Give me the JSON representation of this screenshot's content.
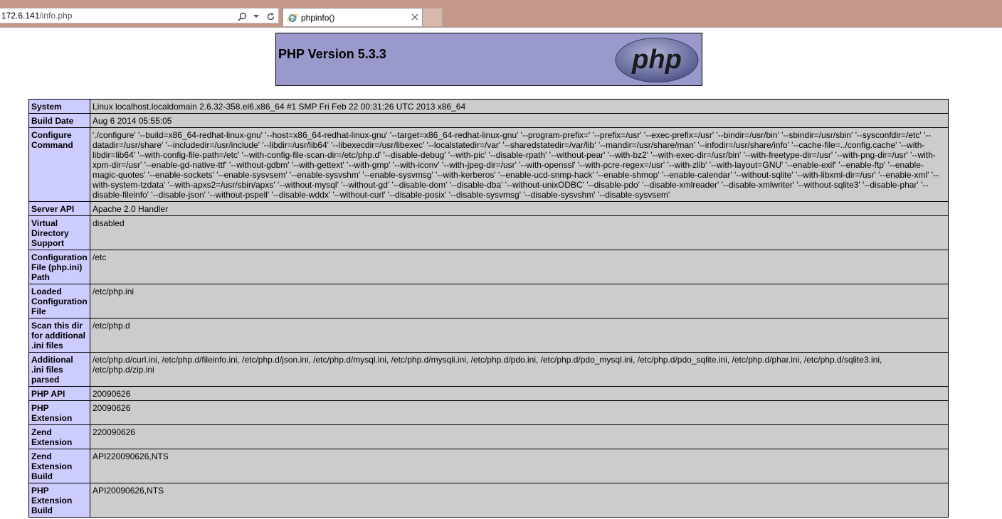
{
  "browser": {
    "address": {
      "host": "172.6.141",
      "path": "/info.php"
    },
    "tab": {
      "title": "phpinfo()"
    },
    "icons": [
      "search-icon",
      "dropdown-icon",
      "refresh-icon",
      "ie-favicon",
      "close-icon"
    ]
  },
  "header": {
    "title": "PHP Version 5.3.3",
    "logo_text": "php",
    "colors": {
      "header_bg": "#9999cc",
      "label_bg": "#ccccff",
      "value_bg": "#cccccc"
    }
  },
  "rows": [
    {
      "label": "System",
      "value": "Linux localhost.localdomain 2.6.32-358.el6.x86_64 #1 SMP Fri Feb 22 00:31:26 UTC 2013 x86_64"
    },
    {
      "label": "Build Date",
      "value": "Aug 6 2014 05:55:05"
    },
    {
      "label": "Configure Command",
      "value": "'./configure' '--build=x86_64-redhat-linux-gnu' '--host=x86_64-redhat-linux-gnu' '--target=x86_64-redhat-linux-gnu' '--program-prefix=' '--prefix=/usr' '--exec-prefix=/usr' '--bindir=/usr/bin' '--sbindir=/usr/sbin' '--sysconfdir=/etc' '--datadir=/usr/share' '--includedir=/usr/include' '--libdir=/usr/lib64' '--libexecdir=/usr/libexec' '--localstatedir=/var' '--sharedstatedir=/var/lib' '--mandir=/usr/share/man' '--infodir=/usr/share/info' '--cache-file=../config.cache' '--with-libdir=lib64' '--with-config-file-path=/etc' '--with-config-file-scan-dir=/etc/php.d' '--disable-debug' '--with-pic' '--disable-rpath' '--without-pear' '--with-bz2' '--with-exec-dir=/usr/bin' '--with-freetype-dir=/usr' '--with-png-dir=/usr' '--with-xpm-dir=/usr' '--enable-gd-native-ttf' '--without-gdbm' '--with-gettext' '--with-gmp' '--with-iconv' '--with-jpeg-dir=/usr' '--with-openssl' '--with-pcre-regex=/usr' '--with-zlib' '--with-layout=GNU' '--enable-exif' '--enable-ftp' '--enable-magic-quotes' '--enable-sockets' '--enable-sysvsem' '--enable-sysvshm' '--enable-sysvmsg' '--with-kerberos' '--enable-ucd-snmp-hack' '--enable-shmop' '--enable-calendar' '--without-sqlite' '--with-libxml-dir=/usr' '--enable-xml' '--with-system-tzdata' '--with-apxs2=/usr/sbin/apxs' '--without-mysql' '--without-gd' '--disable-dom' '--disable-dba' '--without-unixODBC' '--disable-pdo' '--disable-xmlreader' '--disable-xmlwriter' '--without-sqlite3' '--disable-phar' '--disable-fileinfo' '--disable-json' '--without-pspell' '--disable-wddx' '--without-curl' '--disable-posix' '--disable-sysvmsg' '--disable-sysvshm' '--disable-sysvsem'"
    },
    {
      "label": "Server API",
      "value": "Apache 2.0 Handler"
    },
    {
      "label": "Virtual Directory Support",
      "value": "disabled"
    },
    {
      "label": "Configuration File (php.ini) Path",
      "value": "/etc"
    },
    {
      "label": "Loaded Configuration File",
      "value": "/etc/php.ini"
    },
    {
      "label": "Scan this dir for additional .ini files",
      "value": "/etc/php.d"
    },
    {
      "label": "Additional .ini files parsed",
      "value": "/etc/php.d/curl.ini, /etc/php.d/fileinfo.ini, /etc/php.d/json.ini, /etc/php.d/mysql.ini, /etc/php.d/mysqli.ini, /etc/php.d/pdo.ini, /etc/php.d/pdo_mysql.ini, /etc/php.d/pdo_sqlite.ini, /etc/php.d/phar.ini, /etc/php.d/sqlite3.ini, /etc/php.d/zip.ini"
    },
    {
      "label": "PHP API",
      "value": "20090626"
    },
    {
      "label": "PHP Extension",
      "value": "20090626"
    },
    {
      "label": "Zend Extension",
      "value": "220090626"
    },
    {
      "label": "Zend Extension Build",
      "value": "API220090626,NTS"
    },
    {
      "label": "PHP Extension Build",
      "value": "API20090626,NTS"
    }
  ]
}
